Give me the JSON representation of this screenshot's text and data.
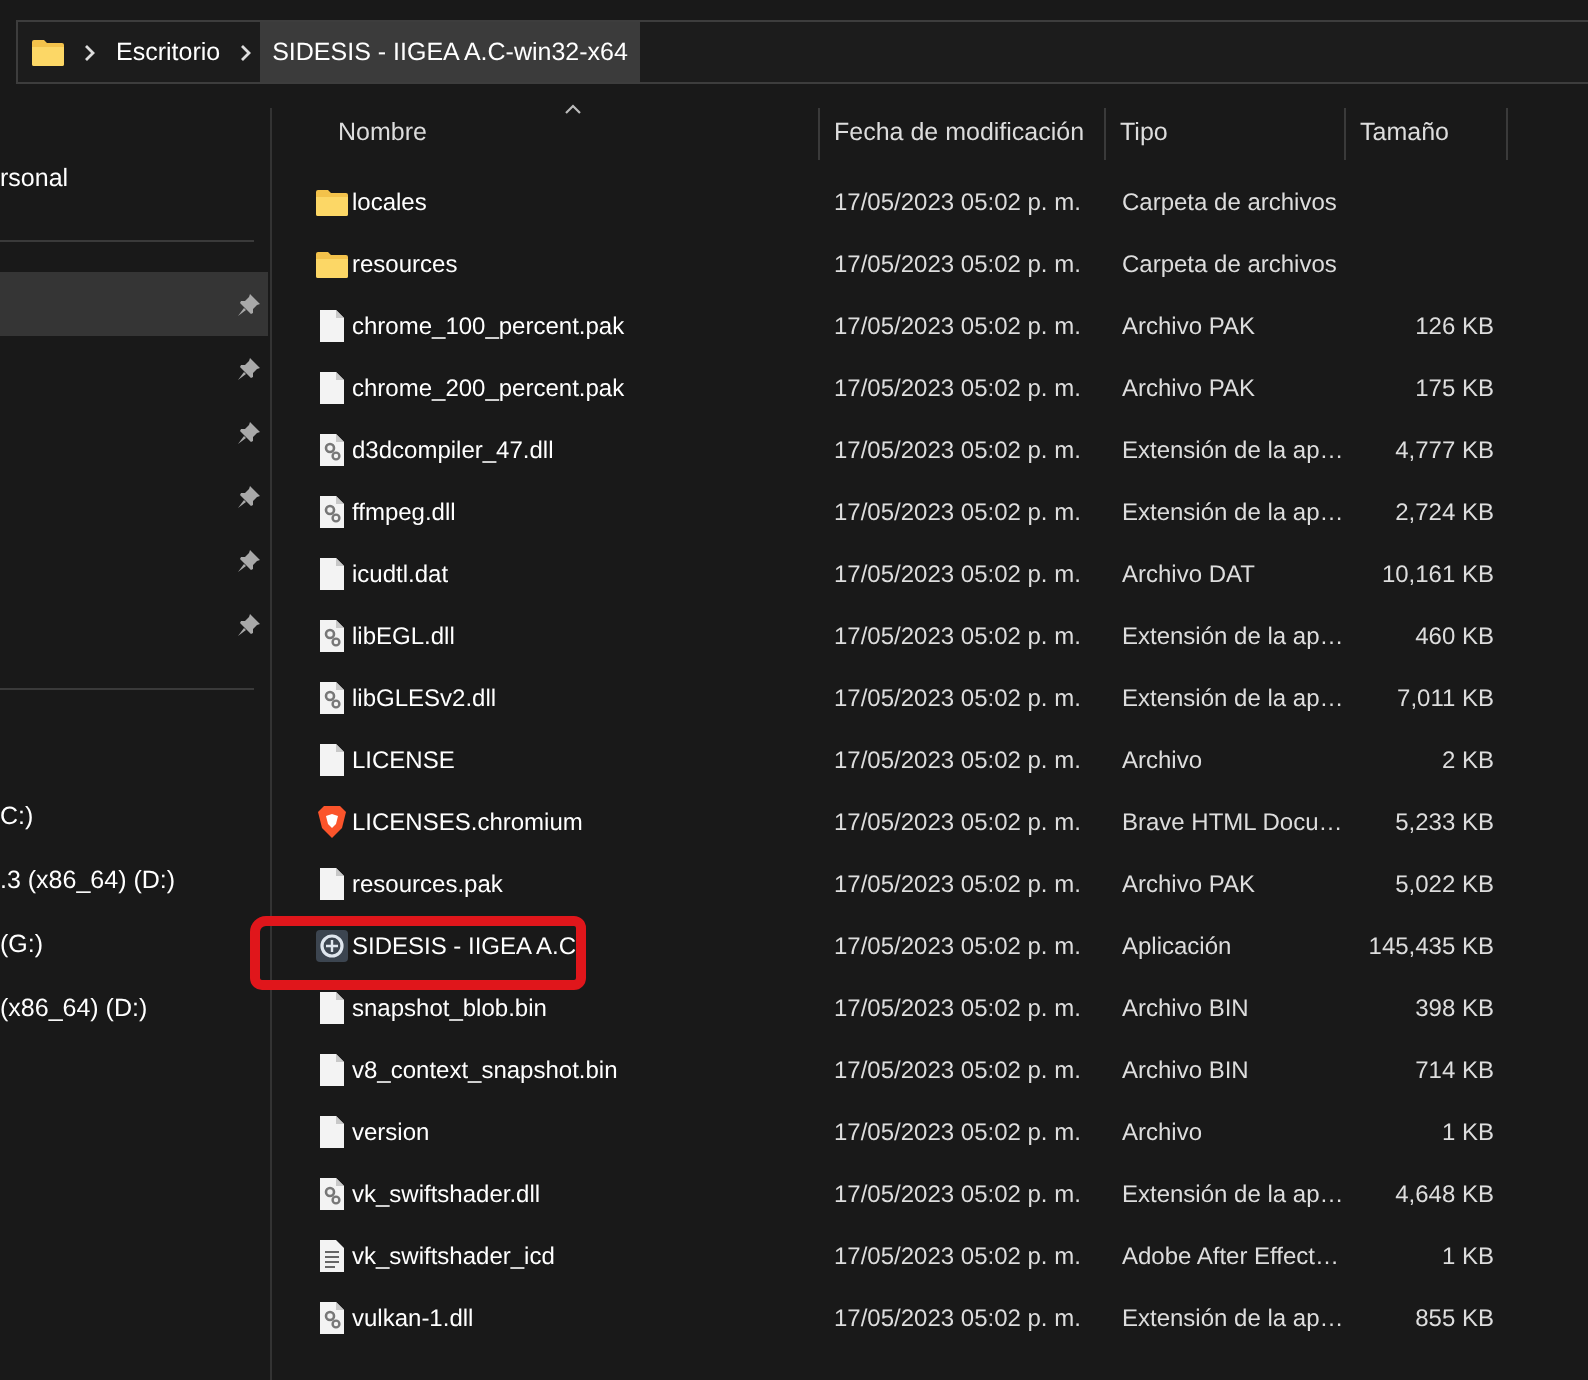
{
  "address_bar": {
    "crumbs": [
      "Escritorio",
      "SIDESIS - IIGEA A.C-win32-x64"
    ]
  },
  "sidebar": {
    "top_items": [
      {
        "label": "rsonal"
      }
    ],
    "pinned_items": [
      {
        "selected": true,
        "pinned": true
      },
      {
        "selected": false,
        "pinned": true
      },
      {
        "selected": false,
        "pinned": true
      },
      {
        "selected": false,
        "pinned": true
      },
      {
        "selected": false,
        "pinned": true
      },
      {
        "selected": false,
        "pinned": true
      }
    ],
    "drives": [
      {
        "label": "C:)"
      },
      {
        "label": ".3 (x86_64) (D:)"
      },
      {
        "label": "(G:)"
      },
      {
        "label": "(x86_64) (D:)"
      }
    ]
  },
  "file_list": {
    "columns": [
      {
        "label": "Nombre",
        "sorted": true
      },
      {
        "label": "Fecha de modificación",
        "sorted": false
      },
      {
        "label": "Tipo",
        "sorted": false
      },
      {
        "label": "Tamaño",
        "sorted": false
      }
    ],
    "rows": [
      {
        "kind": "folder",
        "name": "locales",
        "modified": "17/05/2023 05:02 p. m.",
        "type": "Carpeta de archivos",
        "highlighted": false
      },
      {
        "kind": "folder",
        "name": "resources",
        "modified": "17/05/2023 05:02 p. m.",
        "type": "Carpeta de archivos",
        "highlighted": false
      },
      {
        "kind": "file",
        "name": "chrome_100_percent.pak",
        "modified": "17/05/2023 05:02 p. m.",
        "type": "Archivo PAK",
        "size": "126 KB",
        "highlighted": false
      },
      {
        "kind": "file",
        "name": "chrome_200_percent.pak",
        "modified": "17/05/2023 05:02 p. m.",
        "type": "Archivo PAK",
        "size": "175 KB",
        "highlighted": false
      },
      {
        "kind": "dll",
        "name": "d3dcompiler_47.dll",
        "modified": "17/05/2023 05:02 p. m.",
        "type": "Extensión de la ap…",
        "size": "4,777 KB",
        "highlighted": false
      },
      {
        "kind": "dll",
        "name": "ffmpeg.dll",
        "modified": "17/05/2023 05:02 p. m.",
        "type": "Extensión de la ap…",
        "size": "2,724 KB",
        "highlighted": false
      },
      {
        "kind": "file",
        "name": "icudtl.dat",
        "modified": "17/05/2023 05:02 p. m.",
        "type": "Archivo DAT",
        "size": "10,161 KB",
        "highlighted": false
      },
      {
        "kind": "dll",
        "name": "libEGL.dll",
        "modified": "17/05/2023 05:02 p. m.",
        "type": "Extensión de la ap…",
        "size": "460 KB",
        "highlighted": false
      },
      {
        "kind": "dll",
        "name": "libGLESv2.dll",
        "modified": "17/05/2023 05:02 p. m.",
        "type": "Extensión de la ap…",
        "size": "7,011 KB",
        "highlighted": false
      },
      {
        "kind": "file",
        "name": "LICENSE",
        "modified": "17/05/2023 05:02 p. m.",
        "type": "Archivo",
        "size": "2 KB",
        "highlighted": false
      },
      {
        "kind": "browser",
        "name": "LICENSES.chromium",
        "modified": "17/05/2023 05:02 p. m.",
        "type": "Brave HTML Docu…",
        "size": "5,233 KB",
        "highlighted": false
      },
      {
        "kind": "file",
        "name": "resources.pak",
        "modified": "17/05/2023 05:02 p. m.",
        "type": "Archivo PAK",
        "size": "5,022 KB",
        "highlighted": false
      },
      {
        "kind": "app",
        "name": "SIDESIS - IIGEA A.C",
        "modified": "17/05/2023 05:02 p. m.",
        "type": "Aplicación",
        "size": "145,435 KB",
        "highlighted": true
      },
      {
        "kind": "file",
        "name": "snapshot_blob.bin",
        "modified": "17/05/2023 05:02 p. m.",
        "type": "Archivo BIN",
        "size": "398 KB",
        "highlighted": false
      },
      {
        "kind": "file",
        "name": "v8_context_snapshot.bin",
        "modified": "17/05/2023 05:02 p. m.",
        "type": "Archivo BIN",
        "size": "714 KB",
        "highlighted": false
      },
      {
        "kind": "file",
        "name": "version",
        "modified": "17/05/2023 05:02 p. m.",
        "type": "Archivo",
        "size": "1 KB",
        "highlighted": false
      },
      {
        "kind": "dll",
        "name": "vk_swiftshader.dll",
        "modified": "17/05/2023 05:02 p. m.",
        "type": "Extensión de la ap…",
        "size": "4,648 KB",
        "highlighted": false
      },
      {
        "kind": "text",
        "name": "vk_swiftshader_icd",
        "modified": "17/05/2023 05:02 p. m.",
        "type": "Adobe After Effect…",
        "size": "1 KB",
        "highlighted": false
      },
      {
        "kind": "dll",
        "name": "vulkan-1.dll",
        "modified": "17/05/2023 05:02 p. m.",
        "type": "Extensión de la ap…",
        "size": "855 KB",
        "highlighted": false
      }
    ]
  }
}
